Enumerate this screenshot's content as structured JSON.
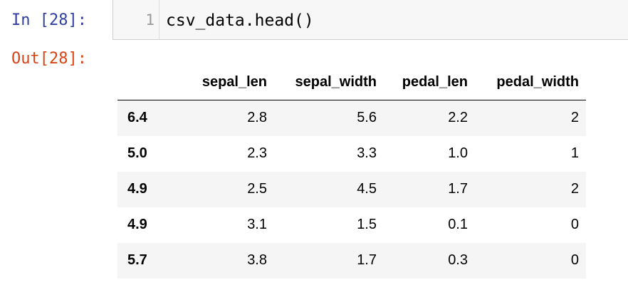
{
  "input_cell": {
    "prompt": "In [28]:",
    "line_number": "1",
    "code": "csv_data.head()"
  },
  "output_cell": {
    "prompt": "Out[28]:"
  },
  "table": {
    "index_header": "",
    "columns": [
      "sepal_len",
      "sepal_width",
      "pedal_len",
      "pedal_width"
    ],
    "rows": [
      {
        "index": "6.4",
        "cells": [
          "2.8",
          "5.6",
          "2.2",
          "2"
        ]
      },
      {
        "index": "5.0",
        "cells": [
          "2.3",
          "3.3",
          "1.0",
          "1"
        ]
      },
      {
        "index": "4.9",
        "cells": [
          "2.5",
          "4.5",
          "1.7",
          "2"
        ]
      },
      {
        "index": "4.9",
        "cells": [
          "3.1",
          "1.5",
          "0.1",
          "0"
        ]
      },
      {
        "index": "5.7",
        "cells": [
          "3.8",
          "1.7",
          "0.3",
          "0"
        ]
      }
    ]
  },
  "colors": {
    "in_prompt": "#303f9f",
    "out_prompt": "#d84315",
    "input_background": "#f7f7f7",
    "striped_row": "#f5f5f5"
  }
}
